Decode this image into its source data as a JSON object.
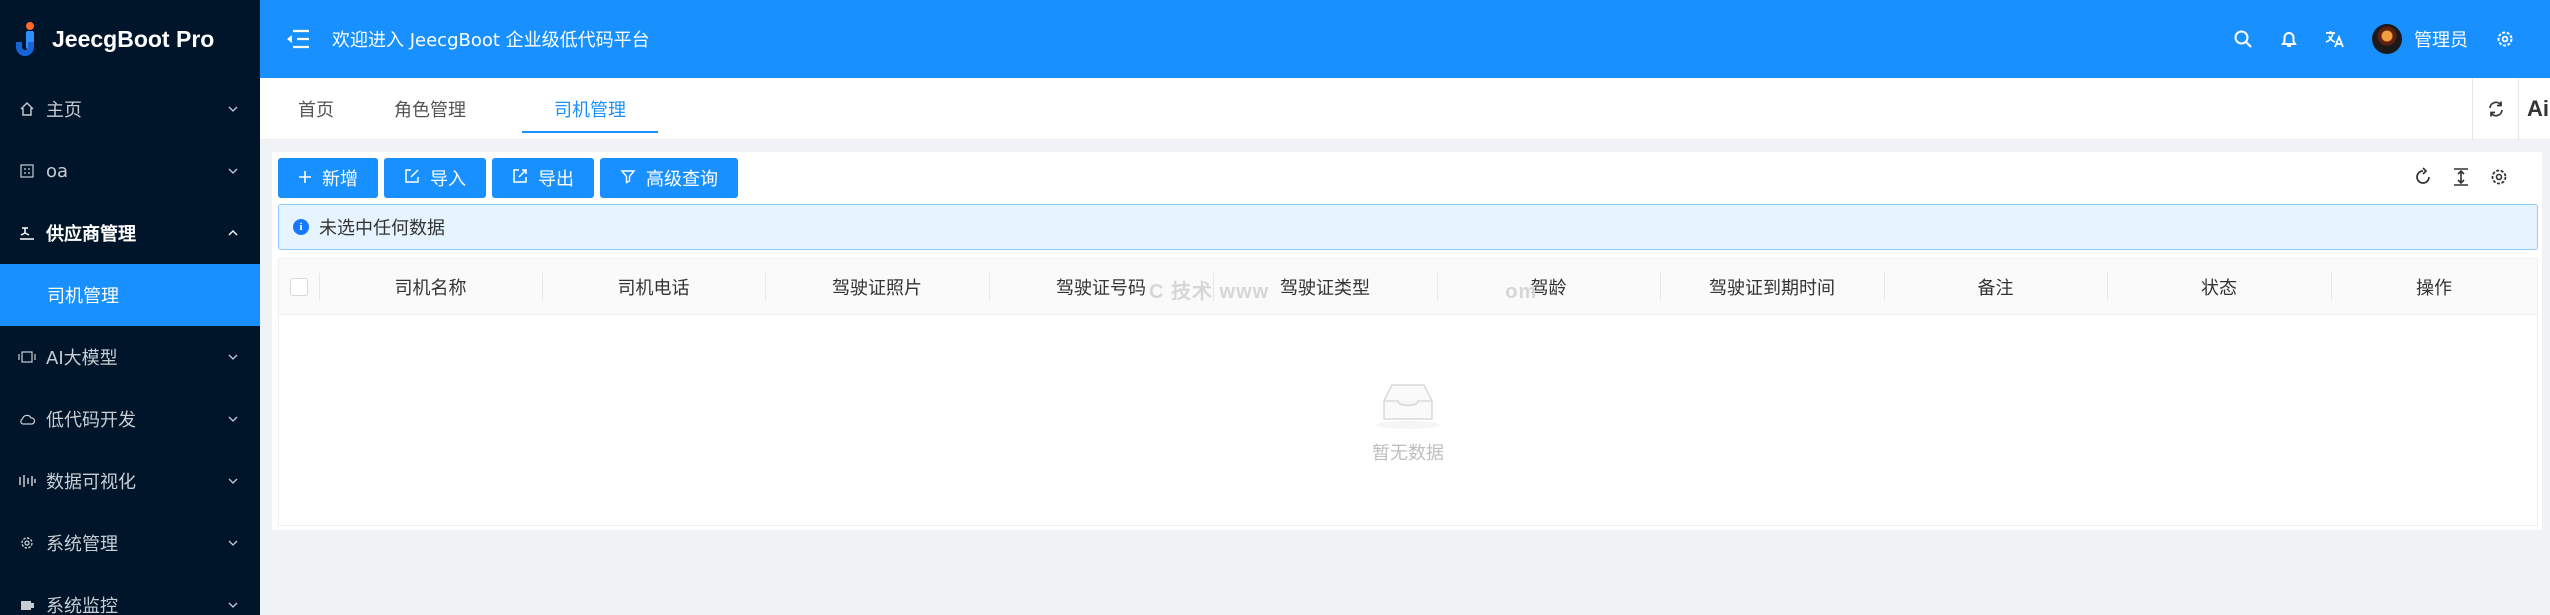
{
  "app": {
    "logo_text": "JeecgBoot Pro",
    "welcome": "欢迎进入 JeecgBoot 企业级低代码平台",
    "username": "管理员",
    "accent": "#1890ff",
    "sidebar_bg": "#001529"
  },
  "sidebar": {
    "items": [
      {
        "label": "主页",
        "icon": "home-icon"
      },
      {
        "label": "oa",
        "icon": "grid-icon"
      },
      {
        "label": "供应商管理",
        "icon": "supplier-icon"
      },
      {
        "label": "司机管理",
        "icon": ""
      },
      {
        "label": "AI大模型",
        "icon": "ai-model-icon"
      },
      {
        "label": "低代码开发",
        "icon": "cloud-icon"
      },
      {
        "label": "数据可视化",
        "icon": "chart-icon"
      },
      {
        "label": "系统管理",
        "icon": "gear-icon"
      },
      {
        "label": "系统监控",
        "icon": "monitor-icon"
      }
    ]
  },
  "tabs": [
    {
      "label": "首页"
    },
    {
      "label": "角色管理"
    },
    {
      "label": "司机管理",
      "active": true
    }
  ],
  "tab_tools": {
    "ai_label": "Ai"
  },
  "toolbar": {
    "add": "新增",
    "import": "导入",
    "export": "导出",
    "advanced_query": "高级查询"
  },
  "alert": {
    "text": "未选中任何数据"
  },
  "table": {
    "columns": [
      "司机名称",
      "司机电话",
      "驾驶证照片",
      "驾驶证号码",
      "驾驶证类型",
      "驾龄",
      "驾驶证到期时间",
      "备注",
      "状态",
      "操作"
    ],
    "watermark": "C 技术  www",
    "watermark_tail": "om",
    "empty_text": "暂无数据"
  }
}
